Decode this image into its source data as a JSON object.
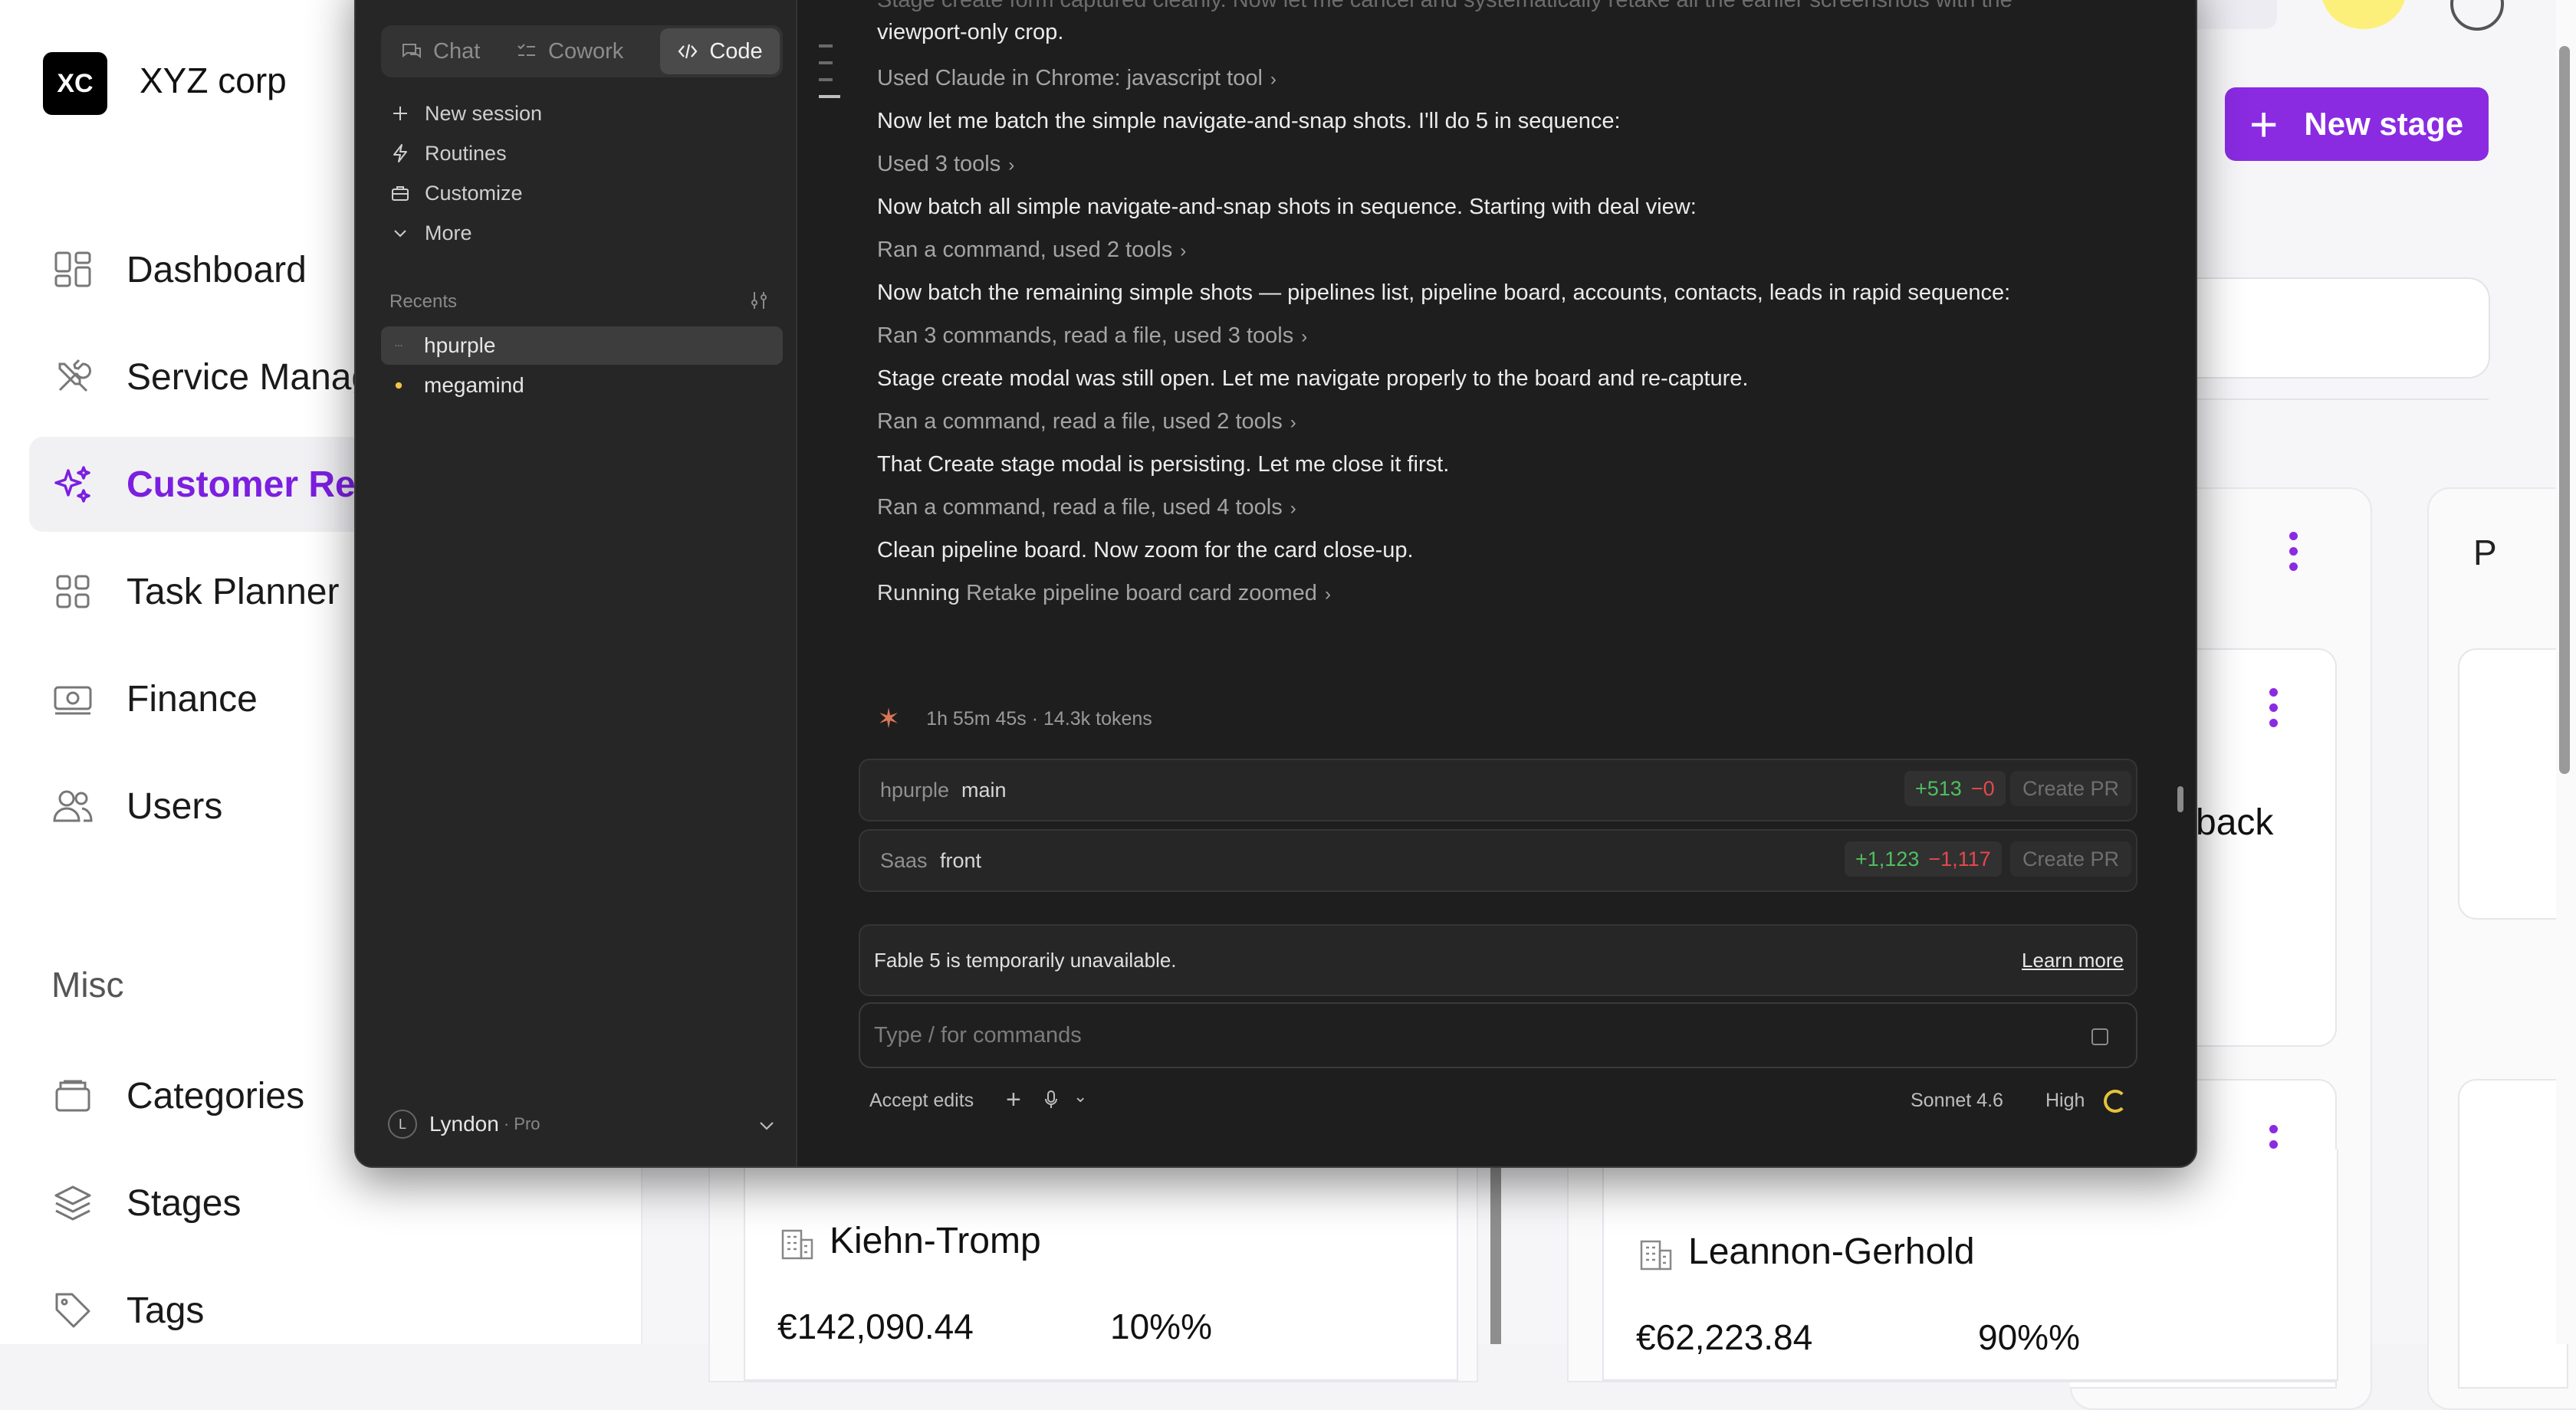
{
  "crm": {
    "logo_initials": "XC",
    "company_name": "XYZ corp",
    "nav": [
      {
        "label": "Dashboard",
        "icon": "dashboard-icon"
      },
      {
        "label": "Service Management",
        "icon": "tools-icon"
      },
      {
        "label": "Customer Relationships",
        "icon": "sparkles-icon",
        "active": true
      },
      {
        "label": "Task Planner",
        "icon": "grid-icon"
      },
      {
        "label": "Finance",
        "icon": "money-icon"
      },
      {
        "label": "Users",
        "icon": "users-icon"
      }
    ],
    "misc_heading": "Misc",
    "misc_nav": [
      {
        "label": "Categories",
        "icon": "box-icon"
      },
      {
        "label": "Stages",
        "icon": "layers-icon"
      },
      {
        "label": "Tags",
        "icon": "tag-icon"
      }
    ],
    "new_stage_label": "New stage",
    "partial_column_title": "P",
    "partial_card_text": "back",
    "cards": [
      {
        "name": "Kiehn-Tromp",
        "amount": "€142,090.44",
        "probability": "10%%"
      },
      {
        "name": "Leannon-Gerhold",
        "amount": "€62,223.84",
        "probability": "90%%"
      }
    ],
    "accent_color": "#8a2be2"
  },
  "claude": {
    "tabs": [
      {
        "label": "Chat",
        "icon": "chat-icon"
      },
      {
        "label": "Cowork",
        "icon": "cowork-icon"
      },
      {
        "label": "Code",
        "icon": "code-icon",
        "active": true
      }
    ],
    "menu": [
      {
        "label": "New session",
        "icon": "plus-icon"
      },
      {
        "label": "Routines",
        "icon": "bolt-icon"
      },
      {
        "label": "Customize",
        "icon": "briefcase-icon"
      },
      {
        "label": "More",
        "icon": "chevron-down-icon"
      }
    ],
    "recents_label": "Recents",
    "recents": [
      {
        "label": "hpurple",
        "selected": true
      },
      {
        "label": "megamind",
        "selected": false
      }
    ],
    "user": {
      "initial": "L",
      "name": "Lyndon",
      "plan": "· Pro"
    },
    "log": [
      {
        "kind": "fade",
        "text": "Stage create form captured cleanly. Now let me cancel and systematically retake all the earlier screenshots with the"
      },
      {
        "kind": "msg",
        "text": "viewport-only crop."
      },
      {
        "kind": "tool",
        "text": "Used Claude in Chrome: javascript tool"
      },
      {
        "kind": "msg",
        "text": "Now let me batch the simple navigate-and-snap shots. I'll do 5 in sequence:"
      },
      {
        "kind": "tool",
        "text": "Used 3 tools"
      },
      {
        "kind": "msg",
        "text": "Now batch all simple navigate-and-snap shots in sequence. Starting with deal view:"
      },
      {
        "kind": "tool",
        "text": "Ran a command, used 2 tools"
      },
      {
        "kind": "msg",
        "text": "Now batch the remaining simple shots — pipelines list, pipeline board, accounts, contacts, leads in rapid sequence:"
      },
      {
        "kind": "tool",
        "text": "Ran 3 commands, read a file, used 3 tools"
      },
      {
        "kind": "msg",
        "text": "Stage create modal was still open. Let me navigate properly to the board and re-capture."
      },
      {
        "kind": "tool",
        "text": "Ran a command, read a file, used 2 tools"
      },
      {
        "kind": "msg",
        "text": "That Create stage modal is persisting. Let me close it first."
      },
      {
        "kind": "tool",
        "text": "Ran a command, read a file, used 4 tools"
      },
      {
        "kind": "msg",
        "text": "Clean pipeline board. Now zoom for the card close-up."
      }
    ],
    "running_prefix": "Running",
    "running_target": "Retake pipeline board card zoomed",
    "status_text": "1h 55m 45s · 14.3k tokens",
    "branches": [
      {
        "repo": "hpurple",
        "branch": "main",
        "added": "+513",
        "removed": "−0",
        "pr_label": "Create PR"
      },
      {
        "repo": "Saas",
        "branch": "front",
        "added": "+1,123",
        "removed": "−1,117",
        "pr_label": "Create PR"
      }
    ],
    "notice_text": "Fable 5 is temporarily unavailable.",
    "learn_more": "Learn more",
    "input_placeholder": "Type / for commands",
    "accept_edits": "Accept edits",
    "model": "Sonnet 4.6",
    "effort": "High"
  }
}
